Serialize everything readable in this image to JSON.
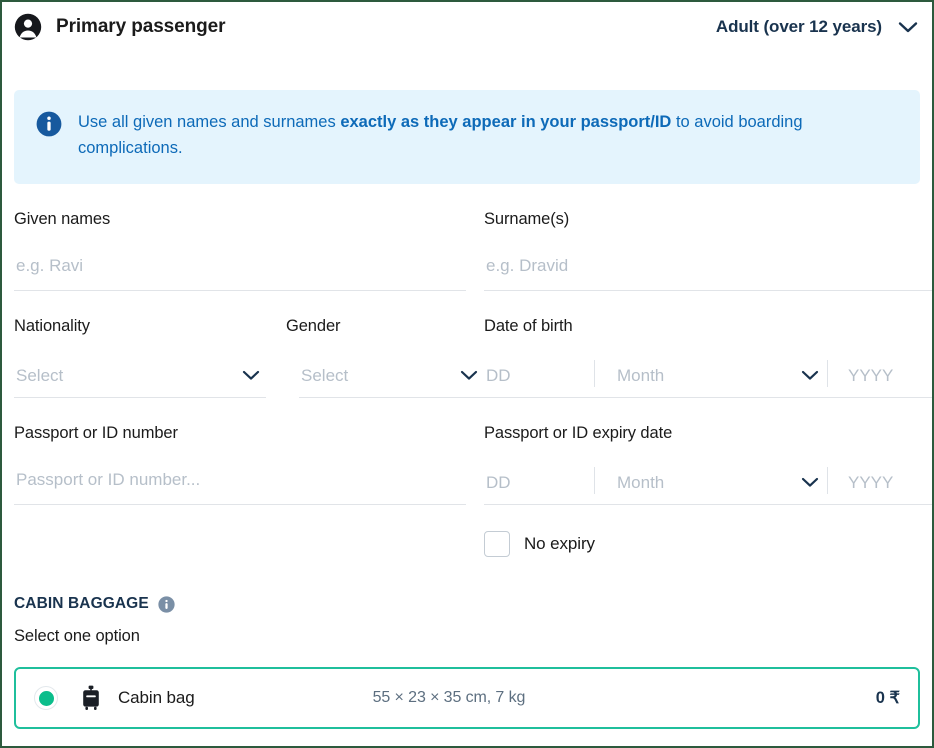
{
  "header": {
    "title": "Primary passenger",
    "avatar_icon": "person-circle-icon",
    "passenger_type": "Adult (over 12 years)",
    "chevron_icon": "chevron-down-icon"
  },
  "banner": {
    "icon": "info-circle-icon",
    "text_before": "Use all given names and surnames ",
    "text_bold": "exactly as they appear in your passport/ID",
    "text_after": " to avoid boarding complications."
  },
  "form": {
    "given_names": {
      "label": "Given names",
      "value": "",
      "placeholder": "e.g. Ravi"
    },
    "surnames": {
      "label": "Surname(s)",
      "value": "",
      "placeholder": "e.g. Dravid"
    },
    "nationality": {
      "label": "Nationality",
      "value": "Select",
      "chevron_icon": "chevron-down-icon"
    },
    "gender": {
      "label": "Gender",
      "value": "Select",
      "chevron_icon": "chevron-down-icon"
    },
    "date_of_birth": {
      "label": "Date of birth",
      "day_placeholder": "DD",
      "month_placeholder": "Month",
      "year_placeholder": "YYYY",
      "chevron_icon": "chevron-down-icon"
    },
    "passport_number": {
      "label": "Passport or ID number",
      "value": "",
      "placeholder": "Passport or ID number..."
    },
    "passport_expiry": {
      "label": "Passport or ID expiry date",
      "day_placeholder": "DD",
      "month_placeholder": "Month",
      "year_placeholder": "YYYY",
      "chevron_icon": "chevron-down-icon"
    },
    "no_expiry": {
      "label": "No expiry",
      "checked": false
    }
  },
  "cabin_baggage": {
    "title": "CABIN BAGGAGE",
    "info_icon": "info-circle-icon",
    "subtitle": "Select one option",
    "options": [
      {
        "name": "Cabin bag",
        "icon": "suitcase-icon",
        "dimensions": "55 × 23 × 35 cm, 7 kg",
        "price": "0 ₹",
        "selected": true
      }
    ]
  },
  "colors": {
    "accent_green": "#0bbd8b",
    "banner_bg": "#e4f4fd",
    "banner_text": "#0d6ab8",
    "page_border": "#2d5a3d",
    "placeholder": "#b6bfc9"
  }
}
